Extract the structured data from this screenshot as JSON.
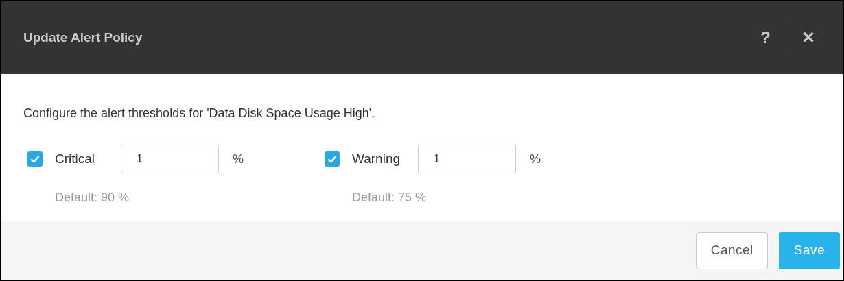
{
  "dialog": {
    "title": "Update Alert Policy",
    "help": "?",
    "close": "✕"
  },
  "description": "Configure the alert thresholds for 'Data Disk Space Usage High'.",
  "thresholds": [
    {
      "label": "Critical",
      "checked": true,
      "value": "1",
      "unit": "%",
      "default": "Default: 90 %"
    },
    {
      "label": "Warning",
      "checked": true,
      "value": "1",
      "unit": "%",
      "default": "Default: 75 %"
    }
  ],
  "buttons": [
    {
      "label": "Cancel",
      "kind": "secondary"
    },
    {
      "label": "Save",
      "kind": "primary"
    }
  ]
}
